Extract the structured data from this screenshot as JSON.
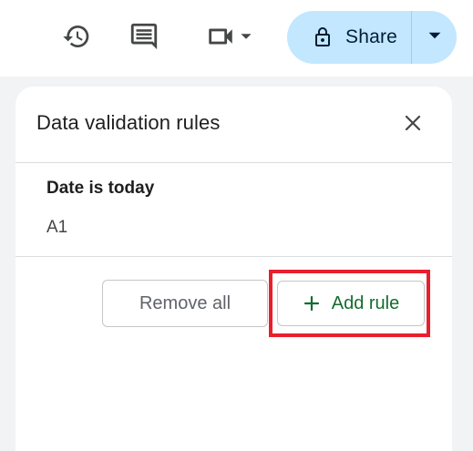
{
  "toolbar": {
    "icons": {
      "history": "history-icon",
      "comments": "comment-icon",
      "meet": "video-camera-icon",
      "meet_dropdown": "caret-down-icon"
    },
    "share": {
      "label": "Share",
      "icon": "lock-icon",
      "dropdown_icon": "caret-down-icon",
      "background": "#c2e7ff"
    }
  },
  "panel": {
    "title": "Data validation rules",
    "close_icon": "close-icon",
    "rules": [
      {
        "title": "Date is today",
        "range": "A1"
      }
    ],
    "remove_all_label": "Remove all",
    "add_rule_label": "Add rule",
    "add_rule_icon": "plus-icon",
    "add_rule_color": "#146c2e",
    "highlight_color": "#e8202e"
  }
}
